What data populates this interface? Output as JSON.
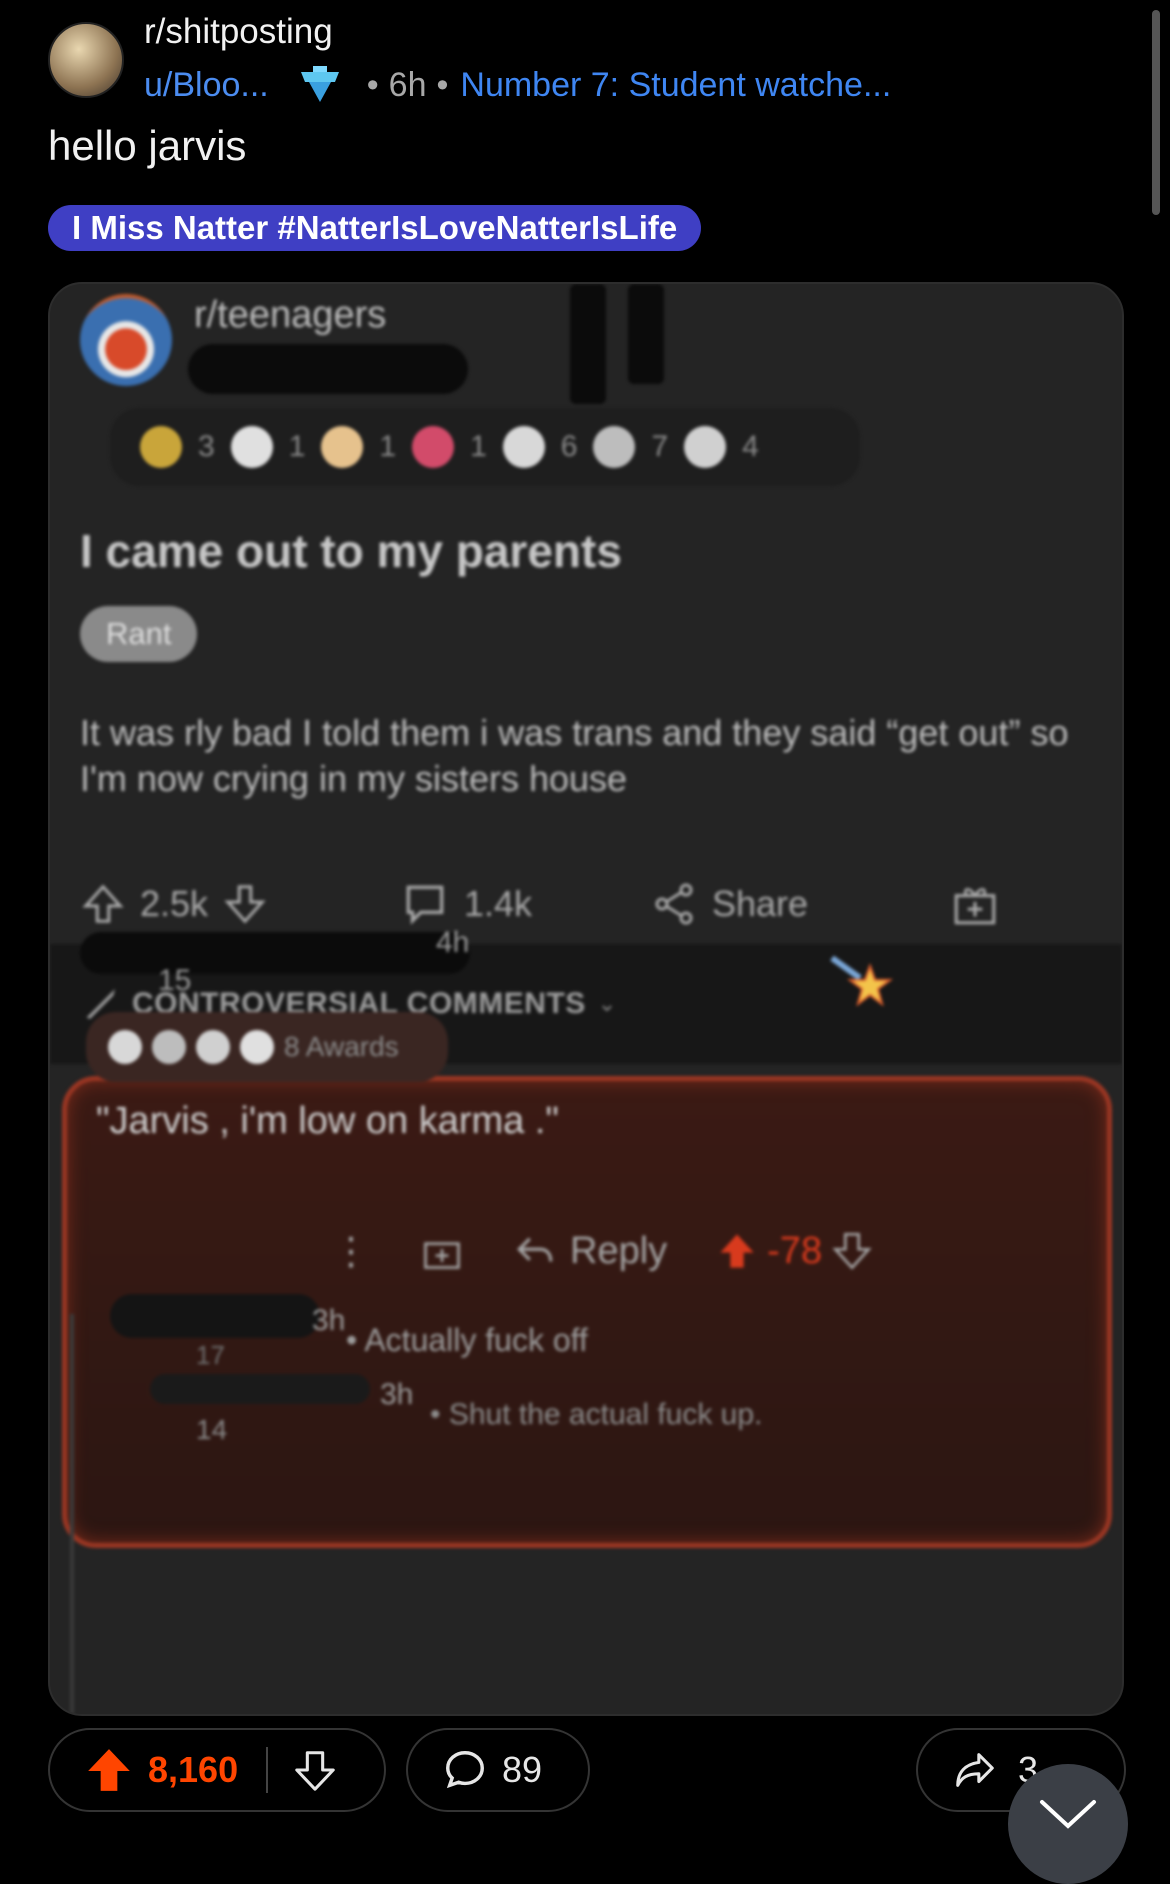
{
  "header": {
    "subreddit": "r/shitposting",
    "username": "u/Bloo...",
    "time": "6h",
    "separator": "•",
    "flair_link": "Number 7: Student watche...",
    "title": "hello jarvis",
    "post_flair": "I Miss Natter #NatterIsLoveNatterIsLife"
  },
  "embedded": {
    "subreddit": "r/teenagers",
    "awards": [
      {
        "icon": "laugh-award-icon",
        "count": "3",
        "color": "#c9a53a"
      },
      {
        "icon": "snoo-award-icon",
        "count": "1",
        "color": "#e0e0e0"
      },
      {
        "icon": "wholesome-award-icon",
        "count": "1",
        "color": "#e6c28d"
      },
      {
        "icon": "heart-award-icon",
        "count": "1",
        "color": "#d24b6a"
      },
      {
        "icon": "silver-award-icon",
        "count": "6",
        "color": "#d8d8d8"
      },
      {
        "icon": "helpful-award-icon",
        "count": "7",
        "color": "#bdbdbd"
      },
      {
        "icon": "bubble-award-icon",
        "count": "4",
        "color": "#d0d0d0"
      }
    ],
    "title": "I came out to my parents",
    "tag": "Rant",
    "body": "It was rly bad I told them i was trans and they said “get out” so I'm now crying in my sisters house",
    "upvotes": "2.5k",
    "comments": "1.4k",
    "share": "Share",
    "sort_label": "CONTROVERSIAL COMMENTS",
    "comment": {
      "time": "4h",
      "score": "15",
      "awards_label": "8 Awards",
      "text": "\"Jarvis , i'm low on karma .\"",
      "reply_label": "Reply",
      "vote": "-78"
    },
    "replies": [
      {
        "time": "3h",
        "score": "17",
        "text": "• Actually fuck off"
      },
      {
        "time": "3h",
        "score": "14",
        "text": "• Shut the actual fuck up."
      }
    ]
  },
  "footer": {
    "votes": "8,160",
    "comments": "89",
    "shares": "3‥"
  },
  "colors": {
    "upvote": "#ff4500",
    "link": "#4b8cf0",
    "flair_bg": "#3f3fc4"
  }
}
